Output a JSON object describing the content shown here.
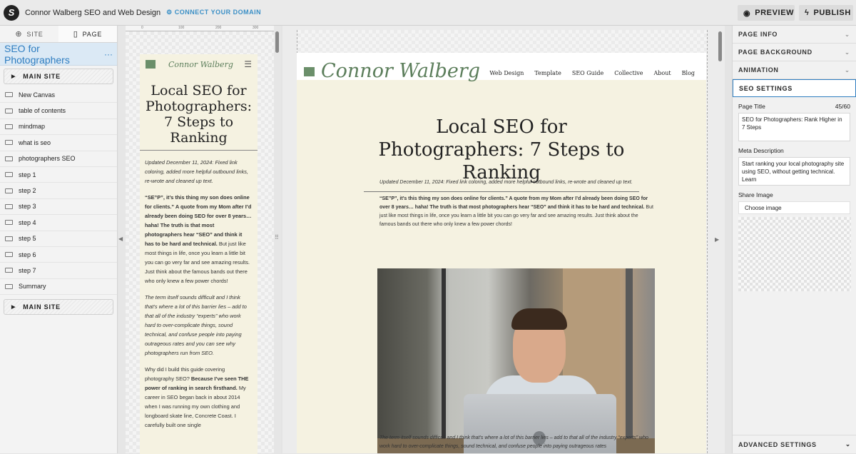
{
  "topbar": {
    "site_name": "Connor Walberg SEO and Web Design",
    "connect_domain": "CONNECT YOUR DOMAIN",
    "preview": "PREVIEW",
    "publish": "PUBLISH"
  },
  "left": {
    "tabs": [
      {
        "label": "SITE"
      },
      {
        "label": "PAGE"
      }
    ],
    "page_title": "SEO for Photographers",
    "main_site": "MAIN SITE",
    "items": [
      {
        "label": "New Canvas"
      },
      {
        "label": "table of contents"
      },
      {
        "label": "mindmap"
      },
      {
        "label": "what is seo"
      },
      {
        "label": "photographers SEO"
      },
      {
        "label": "step 1"
      },
      {
        "label": "step 2"
      },
      {
        "label": "step 3"
      },
      {
        "label": "step 4"
      },
      {
        "label": "step 5"
      },
      {
        "label": "step 6"
      },
      {
        "label": "step 7"
      },
      {
        "label": "Summary"
      }
    ],
    "main_site_bottom": "MAIN SITE"
  },
  "ruler": {
    "t0": "0",
    "t1": "100",
    "t2": "200",
    "t3": "300"
  },
  "mobile": {
    "brand": "Connor Walberg",
    "title": "Local SEO for Photographers: 7 Steps to Ranking",
    "updated": "Updated December 11, 2024: Fixed link coloring, added more helpful outbound links, re-wrote and cleaned up text.",
    "p1_bold": "“SE”P”, it’s this thing my son does online for clients.” A quote from my Mom after I’d already been doing SEO for over 8 years… haha! The truth is that most photographers hear “SEO” and think it has to be hard and technical.",
    "p1_rest": " But just like most things in life, once you learn a little bit you can go very far and see amazing results. Just think about the famous bands out there who only knew a few power chords!",
    "p2": "The term itself sounds difficult and I think that’s where a lot of this barrier lies – add to that all of the industry “experts” who work hard to over-complicate things, sound technical, and confuse people into paying outrageous rates and you can see why photographers run from SEO.",
    "p3_a": "Why did I build this guide covering photography SEO? ",
    "p3_b": "Because I’ve seen THE power of ranking in search firsthand.",
    "p3_c": " My career in SEO began back in about 2014 when I was running my own clothing and longboard skate line, Concrete Coast. I carefully built one single"
  },
  "desktop": {
    "brand": "Connor Walberg",
    "nav": [
      {
        "label": "Web Design"
      },
      {
        "label": "Template"
      },
      {
        "label": "SEO Guide"
      },
      {
        "label": "Collective"
      },
      {
        "label": "About"
      },
      {
        "label": "Blog"
      }
    ],
    "title": "Local SEO for Photographers: 7 Steps to Ranking",
    "updated": "Updated December 11, 2024: Fixed link coloring, added more helpful outbound links, re-wrote and cleaned up text.",
    "p1_bold": "“SE”P”, it’s this thing my son does online for clients.” A quote from my Mom after I’d already been doing SEO for over 8 years… haha! The truth is that most photographers hear “SEO” and think it has to be hard and technical.",
    "p1_rest": " But just like most things in life, once you learn a little bit you can go very far and see amazing results. Just think about the famous bands out there who only knew a few power chords!",
    "p2": "The term itself sounds difficult and I think that’s where a lot of this barrier lies – add to that all of the industry “experts” who work hard to over-complicate things, sound technical, and confuse people into paying outrageous rates"
  },
  "right": {
    "sections": [
      {
        "label": "PAGE INFO"
      },
      {
        "label": "PAGE BACKGROUND"
      },
      {
        "label": "ANIMATION"
      }
    ],
    "seo_settings": "SEO SETTINGS",
    "page_title_label": "Page Title",
    "page_title_count": "45/60",
    "page_title_value": "SEO for Photographers: Rank Higher in 7 Steps",
    "meta_label": "Meta Description",
    "meta_value": "Start ranking your local photography site using SEO, without getting technical. Learn",
    "share_label": "Share Image",
    "choose_image": "Choose image",
    "advanced": "ADVANCED SETTINGS"
  }
}
